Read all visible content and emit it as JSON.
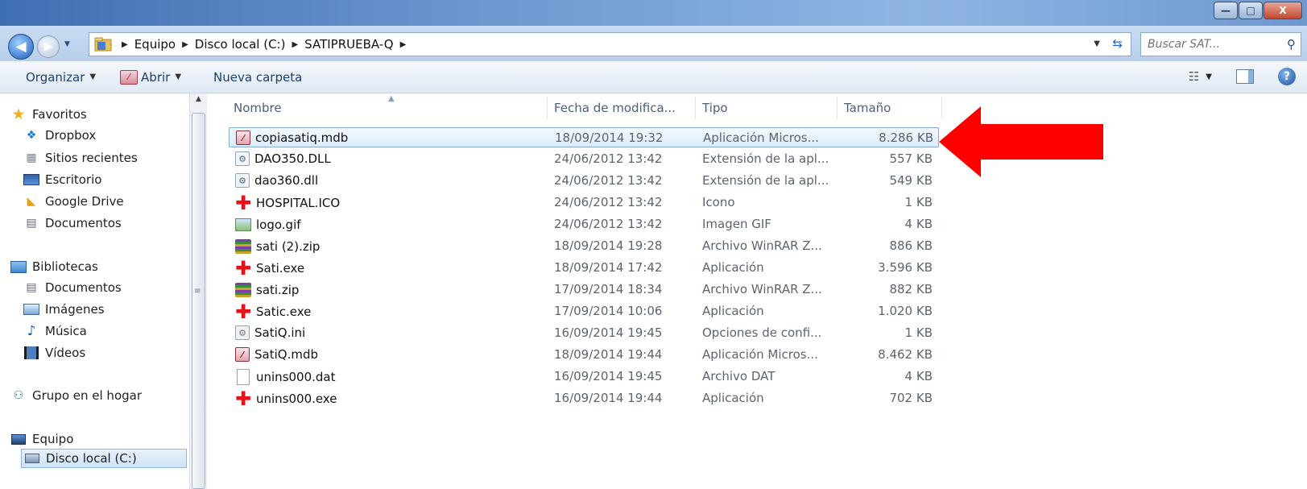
{
  "window": {
    "minimize_label": "—",
    "maximize_label": "□",
    "close_label": "X"
  },
  "address": {
    "crumbs": [
      "Equipo",
      "Disco local (C:)",
      "SATIPRUEBA-Q"
    ],
    "search_placeholder": "Buscar SAT..."
  },
  "toolbar": {
    "organize_label": "Organizar",
    "open_label": "Abrir",
    "new_folder_label": "Nueva carpeta"
  },
  "nav": {
    "favorites": "Favoritos",
    "dropbox": "Dropbox",
    "recent": "Sitios recientes",
    "desktop": "Escritorio",
    "google_drive": "Google Drive",
    "documents": "Documentos",
    "libraries": "Bibliotecas",
    "lib_documents": "Documentos",
    "images": "Imágenes",
    "music": "Música",
    "videos": "Vídeos",
    "homegroup": "Grupo en el hogar",
    "computer": "Equipo",
    "local_disk": "Disco local (C:)"
  },
  "columns": {
    "name": "Nombre",
    "date": "Fecha de modifica...",
    "type": "Tipo",
    "size": "Tamaño"
  },
  "files": [
    {
      "name": "copiasatiq.mdb",
      "date": "18/09/2014 19:32",
      "type": "Aplicación Micros...",
      "size": "8.286 KB",
      "icon": "access-db-icon"
    },
    {
      "name": "DAO350.DLL",
      "date": "24/06/2012 13:42",
      "type": "Extensión de la apl...",
      "size": "557 KB",
      "icon": "dll-icon"
    },
    {
      "name": "dao360.dll",
      "date": "24/06/2012 13:42",
      "type": "Extensión de la apl...",
      "size": "549 KB",
      "icon": "dll-icon"
    },
    {
      "name": "HOSPITAL.ICO",
      "date": "24/06/2012 13:42",
      "type": "Icono",
      "size": "1 KB",
      "icon": "red-cross-icon"
    },
    {
      "name": "logo.gif",
      "date": "24/06/2012 13:42",
      "type": "Imagen GIF",
      "size": "4 KB",
      "icon": "image-icon"
    },
    {
      "name": "sati (2).zip",
      "date": "18/09/2014 19:28",
      "type": "Archivo WinRAR Z...",
      "size": "886 KB",
      "icon": "winrar-icon"
    },
    {
      "name": "Sati.exe",
      "date": "18/09/2014 17:42",
      "type": "Aplicación",
      "size": "3.596 KB",
      "icon": "red-cross-icon"
    },
    {
      "name": "sati.zip",
      "date": "17/09/2014 18:34",
      "type": "Archivo WinRAR Z...",
      "size": "882 KB",
      "icon": "winrar-icon"
    },
    {
      "name": "Satic.exe",
      "date": "17/09/2014 10:06",
      "type": "Aplicación",
      "size": "1.020 KB",
      "icon": "red-cross-icon"
    },
    {
      "name": "SatiQ.ini",
      "date": "16/09/2014 19:45",
      "type": "Opciones de confi...",
      "size": "1 KB",
      "icon": "ini-icon"
    },
    {
      "name": "SatiQ.mdb",
      "date": "18/09/2014 19:44",
      "type": "Aplicación Micros...",
      "size": "8.462 KB",
      "icon": "access-db-icon"
    },
    {
      "name": "unins000.dat",
      "date": "16/09/2014 19:45",
      "type": "Archivo DAT",
      "size": "4 KB",
      "icon": "file-icon"
    },
    {
      "name": "unins000.exe",
      "date": "16/09/2014 19:44",
      "type": "Aplicación",
      "size": "702 KB",
      "icon": "red-cross-icon"
    }
  ],
  "colors": {
    "annotation_arrow": "#ff0000",
    "selection": "#dcebfb"
  }
}
